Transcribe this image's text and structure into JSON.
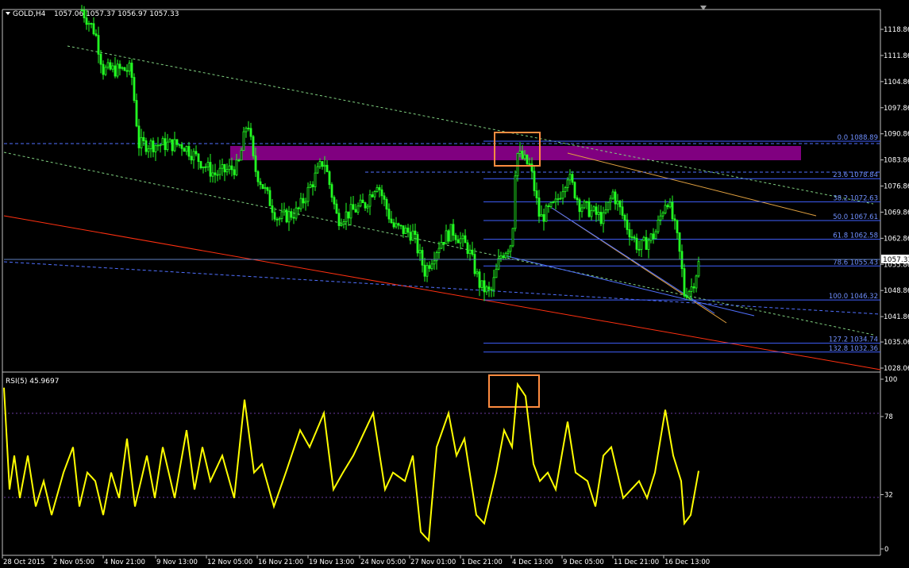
{
  "header": {
    "symbol_timeframe": "GOLD,H4",
    "ohlc": "1057.06 1057.37 1056.97 1057.33"
  },
  "price_axis": {
    "ticks": [
      "1118.86",
      "1111.86",
      "1104.86",
      "1097.86",
      "1090.86",
      "1083.86",
      "1076.86",
      "1069.86",
      "1062.86",
      "1055.86",
      "1048.86",
      "1041.86",
      "1035.06",
      "1028.06"
    ],
    "current_price_label": "1057.33"
  },
  "fibonacci": {
    "levels": [
      {
        "label": "0.0 1088.89",
        "price": 1088.89
      },
      {
        "label": "23.6 1078.84",
        "price": 1078.84
      },
      {
        "label": "38.2 1072.63",
        "price": 1072.63
      },
      {
        "label": "50.0 1067.61",
        "price": 1067.61
      },
      {
        "label": "61.8 1062.58",
        "price": 1062.58
      },
      {
        "label": "78.6 1055.43",
        "price": 1055.43
      },
      {
        "label": "100.0 1046.32",
        "price": 1046.32
      },
      {
        "label": "127.2 1034.74",
        "price": 1034.74
      },
      {
        "label": "132.8 1032.36",
        "price": 1032.36
      }
    ]
  },
  "rsi": {
    "title": "RSI(5) 45.9697",
    "axis_ticks": [
      "100",
      "78",
      "32",
      "0"
    ]
  },
  "time_axis": {
    "labels": [
      "28 Oct 2015",
      "2 Nov 05:00",
      "4 Nov 21:00",
      "9 Nov 13:00",
      "12 Nov 05:00",
      "16 Nov 21:00",
      "19 Nov 13:00",
      "24 Nov 05:00",
      "27 Nov 01:00",
      "1 Dec 21:00",
      "4 Dec 13:00",
      "9 Dec 05:00",
      "11 Dec 21:00",
      "16 Dec 13:00"
    ]
  },
  "colors": {
    "candles": "#22ff22",
    "rsi_line": "#ffff00",
    "resistance_zone": "#800080",
    "highlight_box": "#ff8c40",
    "fib_lines": "#4060ff",
    "channel": "#80d080",
    "trendline_red": "#ff3010",
    "trendline_orange": "#e0a040"
  },
  "chart_data": [
    {
      "type": "line",
      "title": "GOLD,H4",
      "description_values": {
        "x": [
          "28 Oct 2015",
          "2 Nov 05:00",
          "4 Nov 21:00",
          "9 Nov 13:00",
          "12 Nov 05:00",
          "16 Nov 21:00",
          "19 Nov 13:00",
          "24 Nov 05:00",
          "27 Nov 01:00",
          "1 Dec 21:00",
          "4 Dec 13:00",
          "9 Dec 05:00",
          "11 Dec 21:00",
          "16 Dec 13:00"
        ],
        "close": [
          1121,
          1108,
          1090,
          1088,
          1086,
          1070,
          1078,
          1072,
          1058,
          1047,
          1085,
          1075,
          1068,
          1057.33
        ]
      },
      "ylim": [
        1026,
        1123
      ],
      "current": 1057.33
    },
    {
      "type": "line",
      "title": "RSI(5) 45.9697",
      "ylim": [
        0,
        100
      ],
      "levels": [
        78,
        32
      ],
      "current": 45.9697
    }
  ]
}
